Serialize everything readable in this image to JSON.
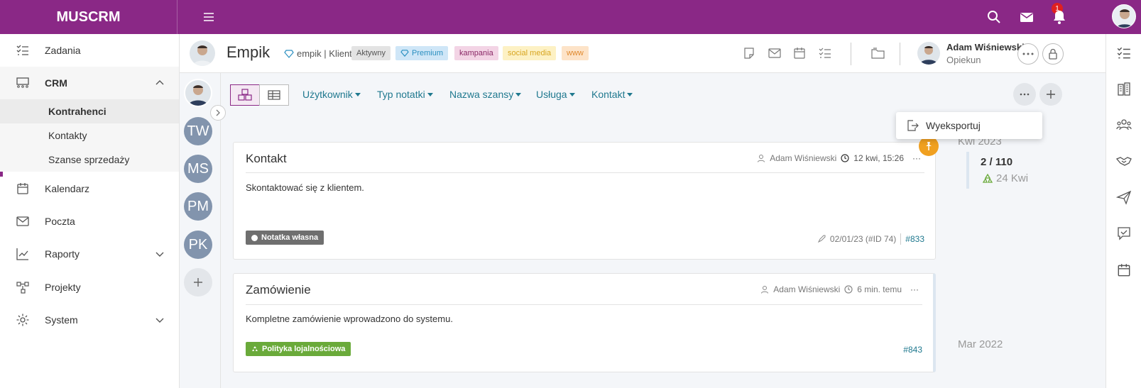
{
  "app": {
    "brand": "MUSCRM"
  },
  "topbar": {
    "mail_count": "1"
  },
  "sidebar": {
    "items": [
      {
        "label": "Zadania"
      },
      {
        "label": "CRM"
      },
      {
        "label": "Kalendarz"
      },
      {
        "label": "Poczta"
      },
      {
        "label": "Raporty"
      },
      {
        "label": "Projekty"
      },
      {
        "label": "System"
      }
    ],
    "crm_sub": [
      {
        "label": "Kontrahenci"
      },
      {
        "label": "Kontakty"
      },
      {
        "label": "Szanse sprzedaży"
      }
    ]
  },
  "header": {
    "company": "Empik",
    "company_type": "empik | Klient",
    "tags": [
      "Aktywny",
      "Premium",
      "kampania",
      "social media",
      "www"
    ],
    "user_name": "Adam Wiśniewski",
    "user_role": "Opiekun"
  },
  "avatars": [
    "TW",
    "MS",
    "PM",
    "PK"
  ],
  "filters": [
    "Użytkownik",
    "Typ notatki",
    "Nazwa szansy",
    "Usługa",
    "Kontakt"
  ],
  "dropdown": {
    "export": "Wyeksportuj"
  },
  "cards": [
    {
      "title": "Kontakt",
      "author": "Adam Wiśniewski",
      "time": "12 kwi, 15:26",
      "body": "Skontaktować się z klientem.",
      "badge": "Notatka własna",
      "ref": "02/01/23 (#ID 74)",
      "id": "#833"
    },
    {
      "title": "Zamówienie",
      "author": "Adam Wiśniewski",
      "time": "6 min. temu",
      "body": "Kompletne zamówienie wprowadzono do systemu.",
      "badge": "Polityka lojalnościowa",
      "id": "#843"
    }
  ],
  "timeline": {
    "year1": "Kwi 2023",
    "count": "2 / 110",
    "date": "24 Kwi",
    "year2": "Mar 2022"
  },
  "colors": {
    "brand": "#8a2886",
    "link": "#20798f",
    "pin": "#f0a020",
    "badge_grey": "#6f6f6f",
    "badge_green": "#6aaa3a"
  }
}
